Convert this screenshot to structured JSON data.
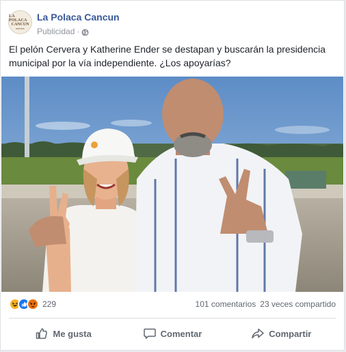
{
  "post": {
    "page_name": "La Polaca Cancun",
    "sponsored_label": "Publicidad",
    "separator": "·",
    "avatar_text": [
      "LA POLACA",
      "CANCUN",
      "noticias"
    ],
    "caption": "El pelón Cervera y Katherine Ender se destapan y buscarán la presidencia municipal por la vía independiente. ¿Los apoyarías?"
  },
  "stats": {
    "reaction_icons": [
      "haha-icon",
      "like-icon",
      "angry-icon"
    ],
    "reaction_count": "229",
    "comments": "101 comentarios",
    "shares": "23 veces compartido"
  },
  "actions": {
    "like": "Me gusta",
    "comment": "Comentar",
    "share": "Compartir"
  },
  "colors": {
    "brand_link": "#385898",
    "muted": "#606770",
    "like_blue": "#1877f2",
    "angry": "#e9710f",
    "haha": "#f7b125"
  }
}
